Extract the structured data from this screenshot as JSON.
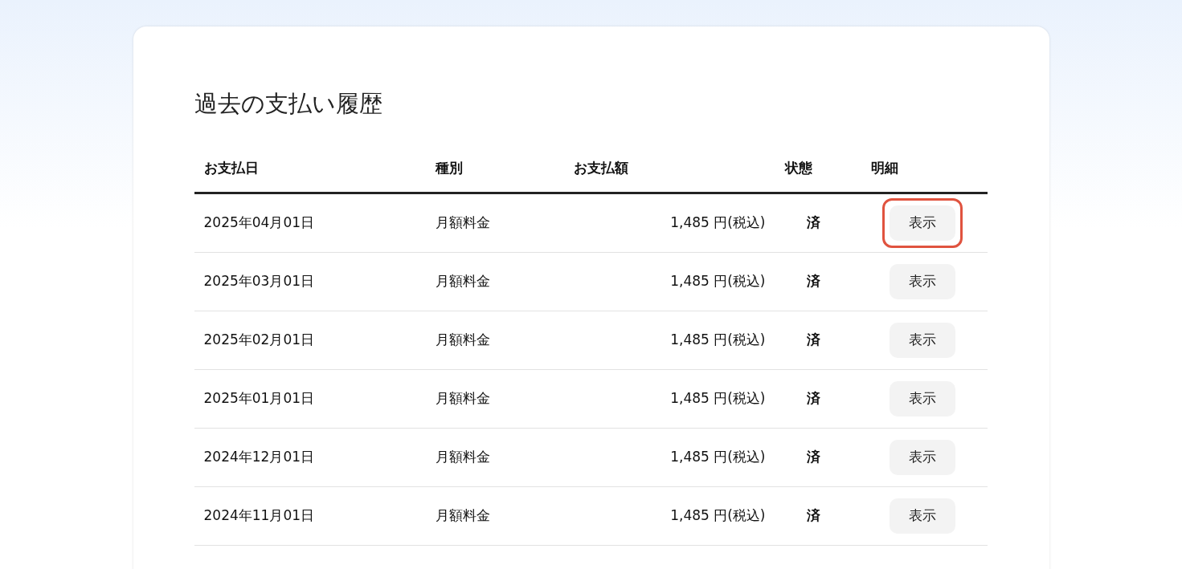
{
  "title": "過去の支払い履歴",
  "table": {
    "columns": [
      "お支払日",
      "種別",
      "お支払額",
      "状態",
      "明細"
    ],
    "rows": [
      {
        "date": "2025年04月01日",
        "type": "月額料金",
        "amount": "1,485 円(税込)",
        "status": "済",
        "action": "表示",
        "highlighted": true
      },
      {
        "date": "2025年03月01日",
        "type": "月額料金",
        "amount": "1,485 円(税込)",
        "status": "済",
        "action": "表示",
        "highlighted": false
      },
      {
        "date": "2025年02月01日",
        "type": "月額料金",
        "amount": "1,485 円(税込)",
        "status": "済",
        "action": "表示",
        "highlighted": false
      },
      {
        "date": "2025年01月01日",
        "type": "月額料金",
        "amount": "1,485 円(税込)",
        "status": "済",
        "action": "表示",
        "highlighted": false
      },
      {
        "date": "2024年12月01日",
        "type": "月額料金",
        "amount": "1,485 円(税込)",
        "status": "済",
        "action": "表示",
        "highlighted": false
      },
      {
        "date": "2024年11月01日",
        "type": "月額料金",
        "amount": "1,485 円(税込)",
        "status": "済",
        "action": "表示",
        "highlighted": false
      }
    ]
  }
}
